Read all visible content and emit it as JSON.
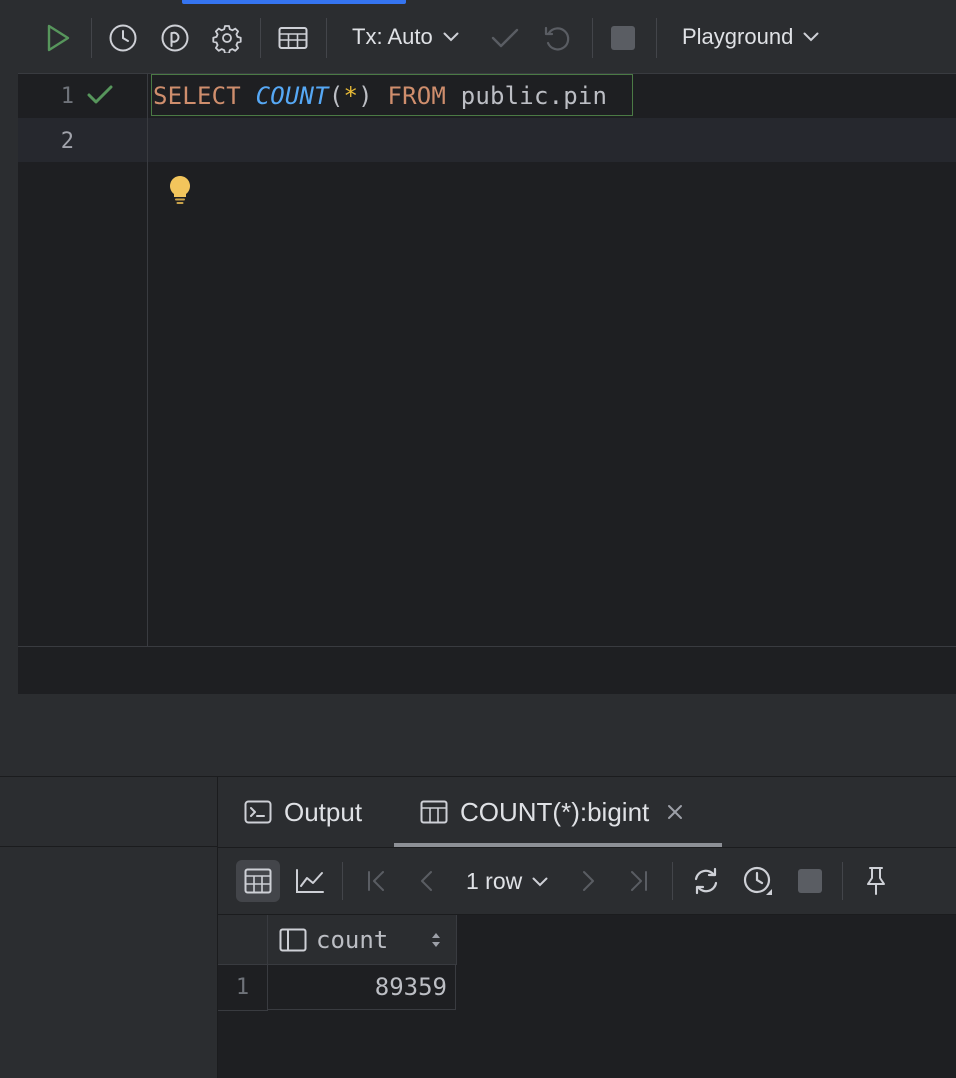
{
  "toolbar": {
    "tx_label": "Tx: Auto",
    "schema_label": "Playground"
  },
  "editor": {
    "line_numbers": [
      "1",
      "2"
    ],
    "code": {
      "select_kw": "SELECT",
      "count_fn": "COUNT",
      "open_paren": "(",
      "star": "*",
      "close_paren": ")",
      "from_kw": "FROM",
      "table": "public.pin"
    }
  },
  "results": {
    "tabs": [
      {
        "label": "Output"
      },
      {
        "label": "COUNT(*):bigint"
      }
    ],
    "pager_label": "1 row",
    "column": {
      "header": "count"
    },
    "rows": [
      {
        "num": "1",
        "count": "89359"
      }
    ]
  },
  "colors": {
    "accent": "#3574f0",
    "run_green": "#57965c",
    "keyword": "#cf8e6d",
    "function": "#56a8f5",
    "bulb": "#f2c55c"
  },
  "icons": [
    "run-icon",
    "history-icon",
    "parameters-icon",
    "settings-icon",
    "table-icon",
    "chevron-down-icon",
    "commit-icon",
    "rollback-icon",
    "stop-icon",
    "check-icon",
    "bulb-icon",
    "console-icon",
    "grid-icon",
    "chart-icon",
    "first-page-icon",
    "prev-page-icon",
    "next-page-icon",
    "last-page-icon",
    "refresh-icon",
    "clock-icon",
    "pin-icon",
    "close-icon",
    "sort-icon"
  ]
}
